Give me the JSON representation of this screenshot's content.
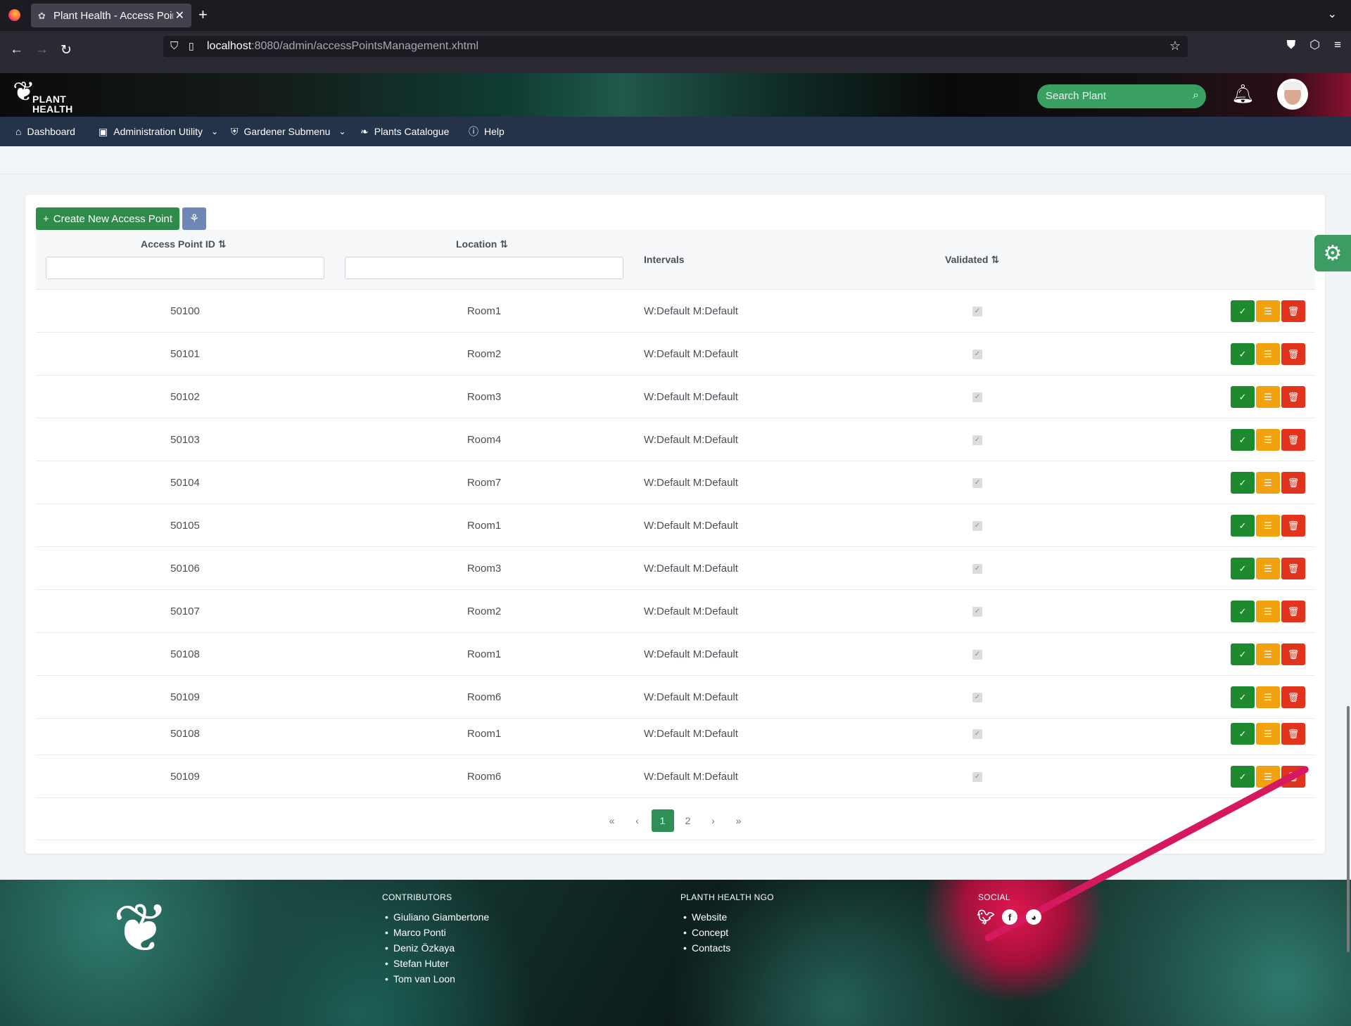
{
  "browser": {
    "tab_title": "Plant Health - Access Point",
    "url_host": "localhost",
    "url_rest": ":8080/admin/accessPointsManagement.xhtml"
  },
  "header": {
    "logo_line1": "PLANT",
    "logo_line2": "HEALTH",
    "search_placeholder": "Search Plant"
  },
  "menu": {
    "items": [
      {
        "label": "Dashboard"
      },
      {
        "label": "Administration Utility"
      },
      {
        "label": "Gardener Submenu"
      },
      {
        "label": "Plants Catalogue"
      },
      {
        "label": "Help"
      }
    ]
  },
  "toolbar": {
    "create_label": "Create New Access Point"
  },
  "table": {
    "columns": {
      "id": "Access Point ID",
      "location": "Location",
      "intervals": "Intervals",
      "validated": "Validated"
    },
    "rows": [
      {
        "id": "50100",
        "location": "Room1",
        "intervals": "W:Default M:Default",
        "validated": true
      },
      {
        "id": "50101",
        "location": "Room2",
        "intervals": "W:Default M:Default",
        "validated": true
      },
      {
        "id": "50102",
        "location": "Room3",
        "intervals": "W:Default M:Default",
        "validated": true
      },
      {
        "id": "50103",
        "location": "Room4",
        "intervals": "W:Default M:Default",
        "validated": true
      },
      {
        "id": "50104",
        "location": "Room7",
        "intervals": "W:Default M:Default",
        "validated": true
      },
      {
        "id": "50105",
        "location": "Room1",
        "intervals": "W:Default M:Default",
        "validated": true
      },
      {
        "id": "50106",
        "location": "Room3",
        "intervals": "W:Default M:Default",
        "validated": true
      },
      {
        "id": "50107",
        "location": "Room2",
        "intervals": "W:Default M:Default",
        "validated": true
      },
      {
        "id": "50108",
        "location": "Room1",
        "intervals": "W:Default M:Default",
        "validated": true
      },
      {
        "id": "50109",
        "location": "Room6",
        "intervals": "W:Default M:Default",
        "validated": true
      },
      {
        "id": "50108",
        "location": "Room1",
        "intervals": "W:Default M:Default",
        "validated": true
      },
      {
        "id": "50109",
        "location": "Room6",
        "intervals": "W:Default M:Default",
        "validated": true
      }
    ]
  },
  "pagination": {
    "first": "«",
    "prev": "‹",
    "pages": [
      "1",
      "2"
    ],
    "current": "1",
    "next": "›",
    "last": "»"
  },
  "footer": {
    "contributors_heading": "CONTRIBUTORS",
    "contributors": [
      "Giuliano Giambertone",
      "Marco Ponti",
      "Deniz Özkaya",
      "Stefan Huter",
      "Tom van Loon"
    ],
    "ngo_heading": "PLANTH HEALTH NGO",
    "ngo_links": [
      "Website",
      "Concept",
      "Contacts"
    ],
    "social_heading": "SOCIAL",
    "social_icons": [
      "twitter-icon",
      "facebook-icon",
      "github-icon"
    ]
  },
  "colors": {
    "accent": "#2e8b4a",
    "menubar": "#24334a",
    "ok": "#1d8a2f",
    "edit": "#f2a20f",
    "delete": "#e2341d"
  }
}
